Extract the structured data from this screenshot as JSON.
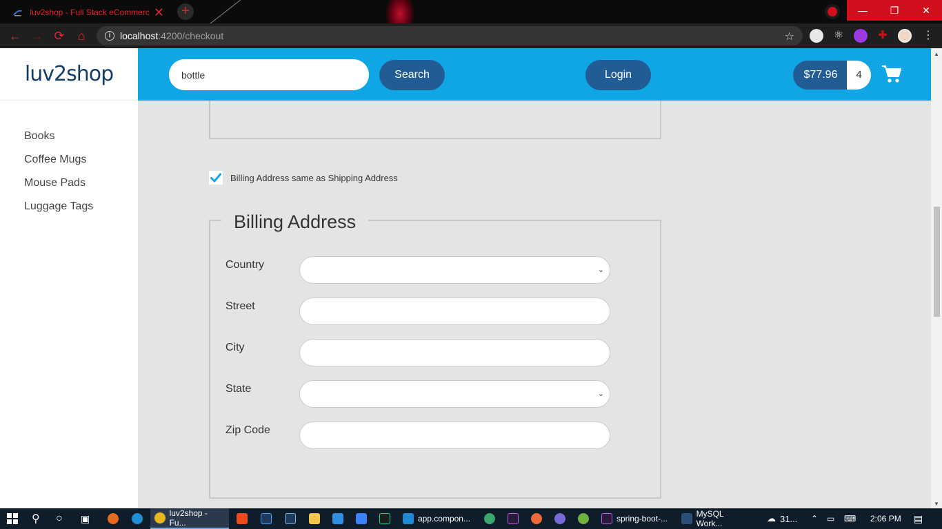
{
  "browser": {
    "tab_title": "luv2shop - Full Stack eCommerce",
    "tab_close": "✕",
    "new_tab": "+",
    "url_host": "localhost",
    "url_path": ":4200/checkout",
    "window_min": "—",
    "window_max": "❐",
    "window_close": "✕"
  },
  "brand": {
    "logo_text": "luv2shop"
  },
  "sidebar": {
    "items": [
      {
        "label": "Books"
      },
      {
        "label": "Coffee Mugs"
      },
      {
        "label": "Mouse Pads"
      },
      {
        "label": "Luggage Tags"
      }
    ]
  },
  "header": {
    "search_value": "bottle",
    "search_label": "Search",
    "login_label": "Login",
    "cart_total": "$77.96",
    "cart_count": "4"
  },
  "checkout": {
    "checkbox_checked": true,
    "checkbox_label": "Billing Address same as Shipping Address",
    "billing_legend": "Billing Address",
    "fields": [
      {
        "label": "Country",
        "type": "select",
        "value": ""
      },
      {
        "label": "Street",
        "type": "text",
        "value": ""
      },
      {
        "label": "City",
        "type": "text",
        "value": ""
      },
      {
        "label": "State",
        "type": "select",
        "value": ""
      },
      {
        "label": "Zip Code",
        "type": "text",
        "value": ""
      }
    ]
  },
  "taskbar": {
    "apps": [
      {
        "label": "luv2shop - Fu..."
      },
      {
        "label": "app.compon..."
      },
      {
        "label": "spring-boot-..."
      },
      {
        "label": "MySQL Work..."
      }
    ],
    "weather": "31...",
    "time": "2:06 PM"
  },
  "colors": {
    "header_bg": "#10a5e4",
    "button_bg": "#225c94",
    "page_bg": "#e4e4e4",
    "accent_red": "#e0242f"
  }
}
